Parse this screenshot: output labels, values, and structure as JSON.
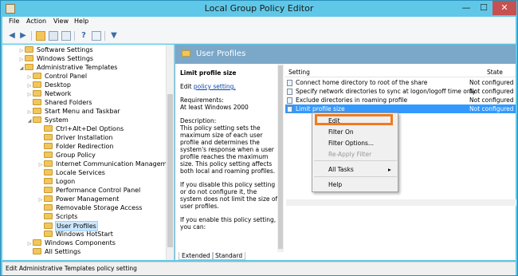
{
  "window": {
    "title": "Local Group Policy Editor",
    "min": "—",
    "max": "☐",
    "close": "✕"
  },
  "menu": [
    "File",
    "Action",
    "View",
    "Help"
  ],
  "tree": [
    {
      "label": "Software Settings",
      "arrow": "▷"
    },
    {
      "label": "Windows Settings",
      "arrow": "▷"
    },
    {
      "label": "Administrative Templates",
      "arrow": "◢"
    },
    {
      "label": "Control Panel",
      "arrow": "▷"
    },
    {
      "label": "Desktop",
      "arrow": "▷"
    },
    {
      "label": "Network",
      "arrow": "▷"
    },
    {
      "label": "Shared Folders",
      "arrow": ""
    },
    {
      "label": "Start Menu and Taskbar",
      "arrow": "▷"
    },
    {
      "label": "System",
      "arrow": "◢"
    },
    {
      "label": "Ctrl+Alt+Del Options",
      "arrow": ""
    },
    {
      "label": "Driver Installation",
      "arrow": ""
    },
    {
      "label": "Folder Redirection",
      "arrow": ""
    },
    {
      "label": "Group Policy",
      "arrow": ""
    },
    {
      "label": "Internet Communication Management",
      "arrow": "▷"
    },
    {
      "label": "Locale Services",
      "arrow": ""
    },
    {
      "label": "Logon",
      "arrow": ""
    },
    {
      "label": "Performance Control Panel",
      "arrow": ""
    },
    {
      "label": "Power Management",
      "arrow": "▷"
    },
    {
      "label": "Removable Storage Access",
      "arrow": ""
    },
    {
      "label": "Scripts",
      "arrow": ""
    },
    {
      "label": "User Profiles",
      "arrow": ""
    },
    {
      "label": "Windows HotStart",
      "arrow": ""
    },
    {
      "label": "Windows Components",
      "arrow": "▷"
    },
    {
      "label": "All Settings",
      "arrow": ""
    }
  ],
  "pane": {
    "title": "User Profiles"
  },
  "description": {
    "heading": "Limit profile size",
    "edit_prefix": "Edit ",
    "edit_link": "policy setting.",
    "requirements": "Requirements:",
    "requirements_value": "At least Windows 2000",
    "description_label": "Description:",
    "description_text": "This policy setting sets the maximum size of each user profile and determines the system's response when a user profile reaches the maximum size. This policy setting affects both local and roaming profiles.",
    "disable_text": "If you disable this policy setting or do not configure it, the system does not limit the size of user profiles.",
    "enable_text": "If you enable this policy setting, you can:"
  },
  "list": {
    "col_setting": "Setting",
    "col_state": "State",
    "rows": [
      {
        "name": "Connect home directory to root of the share",
        "state": "Not configured"
      },
      {
        "name": "Specify network directories to sync at logon/logoff time only",
        "state": "Not configured"
      },
      {
        "name": "Exclude directories in roaming profile",
        "state": "Not configured"
      },
      {
        "name": "Limit profile size",
        "state": "Not configured"
      }
    ]
  },
  "context_menu": {
    "edit": "Edit",
    "filter_on": "Filter On",
    "filter_options": "Filter Options...",
    "reapply": "Re-Apply Filter",
    "all_tasks": "All Tasks",
    "all_tasks_arrow": "▸",
    "help": "Help",
    "highlight_color": "#f07b1e"
  },
  "tabs": [
    "Extended",
    "Standard"
  ],
  "status": "Edit Administrative Templates policy setting",
  "colors": {
    "title_bar": "#5fc8e8",
    "pane_header": "#7ba7c9",
    "selection": "#3399ff",
    "close": "#c75050"
  }
}
